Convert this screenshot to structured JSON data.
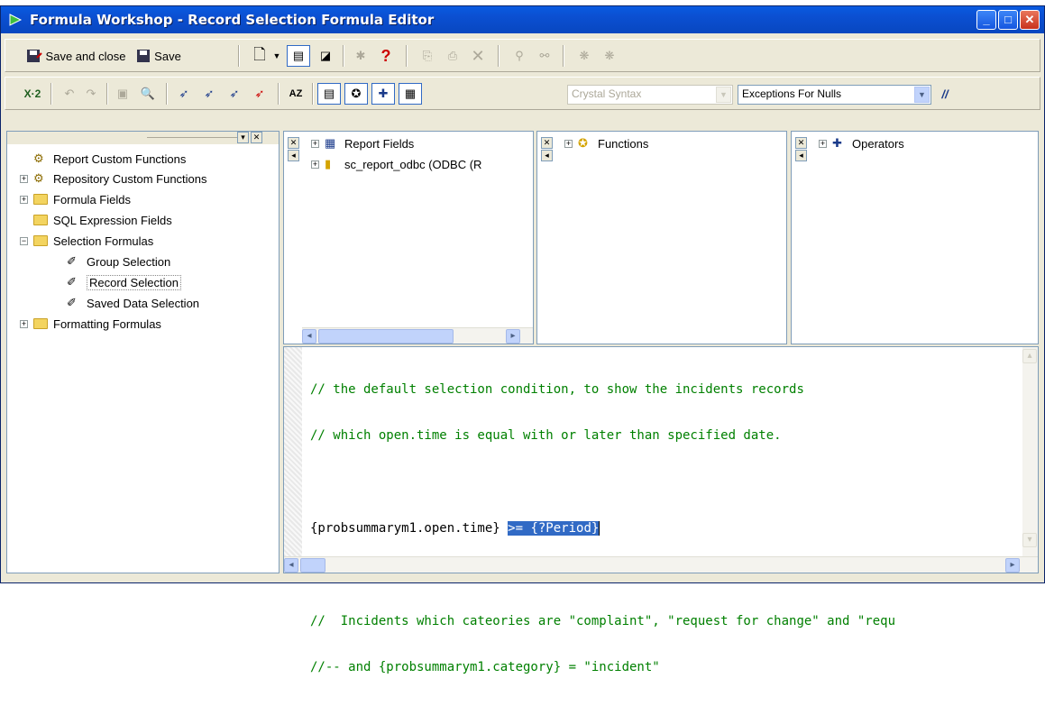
{
  "window": {
    "title": "Formula Workshop - Record Selection Formula Editor"
  },
  "toolbar1": {
    "save_close": "Save and close",
    "save": "Save"
  },
  "toolbar2": {
    "syntax_combo": "Crystal Syntax",
    "nulls_combo": "Exceptions For Nulls",
    "comment_btn": "//"
  },
  "tree": {
    "items": [
      {
        "label": "Report Custom Functions"
      },
      {
        "label": "Repository Custom Functions"
      },
      {
        "label": "Formula Fields"
      },
      {
        "label": "SQL Expression Fields"
      },
      {
        "label": "Selection Formulas"
      },
      {
        "label": "Group Selection"
      },
      {
        "label": "Record Selection"
      },
      {
        "label": "Saved Data Selection"
      },
      {
        "label": "Formatting Formulas"
      }
    ]
  },
  "fields_pane": {
    "items": [
      {
        "label": "Report Fields"
      },
      {
        "label": "sc_report_odbc (ODBC (R"
      }
    ]
  },
  "functions_pane": {
    "label": "Functions"
  },
  "operators_pane": {
    "label": "Operators"
  },
  "editor": {
    "line1": "// the default selection condition, to show the incidents records",
    "line2": "// which open.time is equal with or later than specified date.",
    "line3_field": "{probsummarym1.open.time} ",
    "line3_sel": ">= {?Period}",
    "line4": "//  Incidents which cateories are \"complaint\", \"request for change\" and \"requ",
    "line5": "//-- and {probsummarym1.category} = \"incident\""
  },
  "colors": {
    "title_bar": "#0b4fd1",
    "selection": "#316ac5",
    "comment": "#008000"
  }
}
